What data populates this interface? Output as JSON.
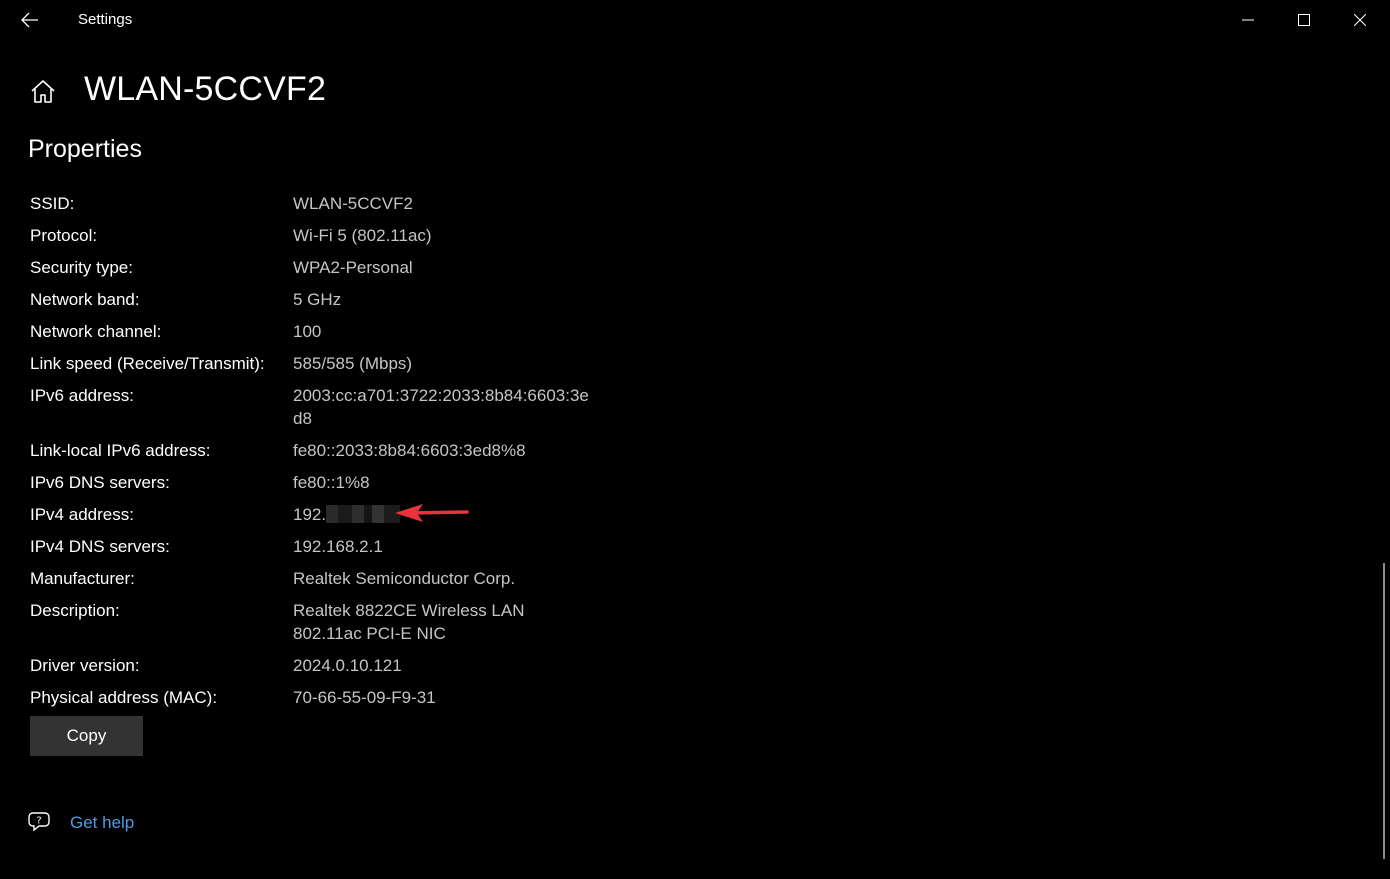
{
  "titlebar": {
    "app_title": "Settings"
  },
  "header": {
    "page_title": "WLAN-5CCVF2",
    "section_title": "Properties"
  },
  "properties": [
    {
      "label": "SSID:",
      "value": "WLAN-5CCVF2"
    },
    {
      "label": "Protocol:",
      "value": "Wi-Fi 5 (802.11ac)"
    },
    {
      "label": "Security type:",
      "value": "WPA2-Personal"
    },
    {
      "label": "Network band:",
      "value": "5 GHz"
    },
    {
      "label": "Network channel:",
      "value": "100"
    },
    {
      "label": "Link speed (Receive/Transmit):",
      "value": "585/585 (Mbps)"
    },
    {
      "label": "IPv6 address:",
      "value": "2003:cc:a701:3722:2033:8b84:6603:3ed8"
    },
    {
      "label": "Link-local IPv6 address:",
      "value": "fe80::2033:8b84:6603:3ed8%8"
    },
    {
      "label": "IPv6 DNS servers:",
      "value": "fe80::1%8"
    },
    {
      "label": "IPv4 address:",
      "value": "192."
    },
    {
      "label": "IPv4 DNS servers:",
      "value": "192.168.2.1"
    },
    {
      "label": "Manufacturer:",
      "value": "Realtek Semiconductor Corp."
    },
    {
      "label": "Description:",
      "value": "Realtek 8822CE Wireless LAN 802.11ac PCI-E NIC"
    },
    {
      "label": "Driver version:",
      "value": "2024.0.10.121"
    },
    {
      "label": "Physical address (MAC):",
      "value": "70-66-55-09-F9-31"
    }
  ],
  "actions": {
    "copy_label": "Copy"
  },
  "help": {
    "link_label": "Get help"
  },
  "icons": {
    "back": "back-arrow-icon",
    "home": "home-icon",
    "minimize": "minimize-icon",
    "maximize": "maximize-icon",
    "close": "close-icon",
    "help": "chat-help-icon",
    "annotation": "red-arrow-icon"
  },
  "colors": {
    "background": "#000000",
    "label_text": "#ffffff",
    "value_text": "#c5c5c5",
    "button_bg": "#333333",
    "link": "#4f9be8",
    "annotation": "#e8323c"
  }
}
